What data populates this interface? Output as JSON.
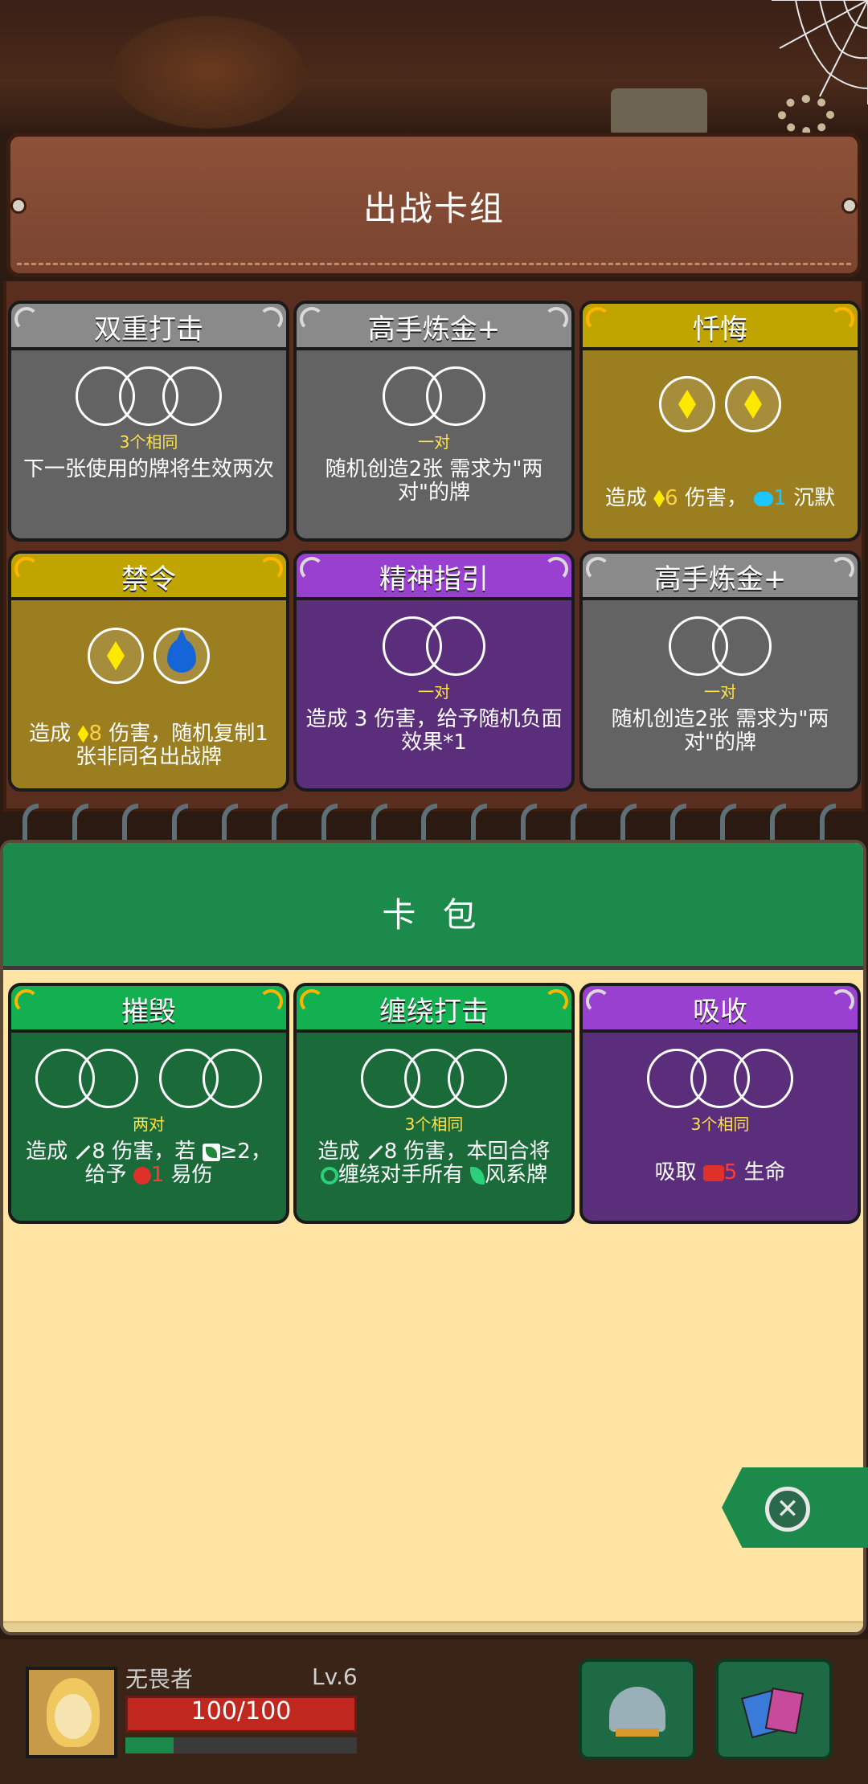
{
  "deck": {
    "title": "出战卡组",
    "cards": [
      {
        "name": "双重打击",
        "rule": "3个相同",
        "desc": "下一张使用的牌将生效两次",
        "color": "#6a6a6a",
        "header_color": "#8a8a8a"
      },
      {
        "name": "高手炼金+",
        "rule": "一对",
        "desc": "随机创造2张 需求为\"两对\"的牌",
        "color": "#6a6a6a",
        "header_color": "#8a8a8a"
      },
      {
        "name": "忏悔",
        "desc_parts": {
          "pre": "造成",
          "num": "6",
          "mid": "伤害，",
          "num2": "1",
          "post": "沉默"
        },
        "color": "#9a7e20",
        "header_color": "#c0a500"
      },
      {
        "name": "禁令",
        "desc_parts": {
          "pre": "造成",
          "num": "8",
          "post": "伤害，随机复制1张非同名出战牌"
        },
        "color": "#9a7e20",
        "header_color": "#c0a500"
      },
      {
        "name": "精神指引",
        "rule": "一对",
        "desc": "造成 3 伤害，给予随机负面效果*1",
        "color": "#5a2e7a",
        "header_color": "#9a40d0"
      },
      {
        "name": "高手炼金+",
        "rule": "一对",
        "desc": "随机创造2张 需求为\"两对\"的牌",
        "color": "#6a6a6a",
        "header_color": "#8a8a8a"
      }
    ]
  },
  "pack": {
    "title": "卡 包",
    "cards": [
      {
        "name": "摧毁",
        "rule": "两对",
        "desc_parts": {
          "pre": "造成",
          "num": "8",
          "mid": "伤害，若",
          "cond": "≥2，",
          "line2a": "给予",
          "num2": "1",
          "line2b": "易伤"
        },
        "color": "#1a6a3a",
        "header_color": "#12b050"
      },
      {
        "name": "缠绕打击",
        "rule": "3个相同",
        "desc_parts": {
          "pre": "造成",
          "num": "8",
          "mid": "伤害，本回合将",
          "line2a": "缠绕对手所有",
          "line2b": "风系牌"
        },
        "color": "#1a6a3a",
        "header_color": "#12b050"
      },
      {
        "name": "吸收",
        "rule": "3个相同",
        "desc_parts": {
          "pre": "吸取",
          "num": "5",
          "post": "生命"
        },
        "color": "#5a2e7a",
        "header_color": "#9a40d0"
      }
    ]
  },
  "player": {
    "name": "无畏者",
    "level": "Lv.6",
    "hp": "100/100",
    "hp_fraction": 1.0,
    "xp_fraction": 0.21
  },
  "icons": [
    "close-icon",
    "helmet-icon",
    "cards-icon",
    "gear-icon",
    "spider-web-icon"
  ]
}
